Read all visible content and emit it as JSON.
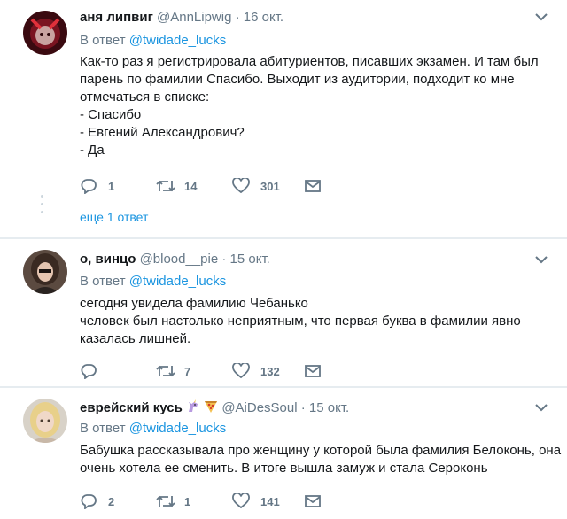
{
  "tweets": [
    {
      "name": "аня липвиг",
      "handle": "@AnnLipwig",
      "separator": "·",
      "date": "16 окт.",
      "reply_prefix": "В ответ",
      "reply_mention": "@twidade_lucks",
      "lines": [
        "Как-то раз я регистрировала абитуриентов, писавших экзамен. И там был",
        "парень по фамилии Спасибо. Выходит из аудитории, подходит ко мне",
        "отмечаться в списке:",
        "- Спасибо",
        "- Евгений Александрович?",
        "- Да"
      ],
      "replies": "1",
      "retweets": "14",
      "likes": "301",
      "more_replies": "еще 1 ответ"
    },
    {
      "name": "о, винцо",
      "handle": "@blood__pie",
      "separator": "·",
      "date": "15 окт.",
      "reply_prefix": "В ответ",
      "reply_mention": "@twidade_lucks",
      "lines": [
        "сегодня увидела фамилию Чебанько",
        "человек был настолько неприятным, что первая буква в фамилии явно",
        "казалась лишней."
      ],
      "replies": "",
      "retweets": "7",
      "likes": "132"
    },
    {
      "name": "еврейский кусь",
      "handle": "@AiDesSoul",
      "separator": "·",
      "date": "15 окт.",
      "reply_prefix": "В ответ",
      "reply_mention": "@twidade_lucks",
      "lines": [
        "Бабушка рассказывала про женщину у которой была фамилия Белоконь, она",
        "очень хотела ее сменить. В итоге вышла замуж и стала Сероконь"
      ],
      "replies": "2",
      "retweets": "1",
      "likes": "141"
    }
  ],
  "icons": {
    "reply": "reply-icon",
    "retweet": "retweet-icon",
    "like": "heart-icon",
    "dm": "envelope-icon",
    "menu": "chevron-down-icon",
    "emoji_1": "unicorn-emoji",
    "emoji_2": "pizza-emoji"
  },
  "colors": {
    "link": "#1b95e0",
    "muted": "#657786",
    "text": "#14171a",
    "divider": "#e6ecf0"
  }
}
